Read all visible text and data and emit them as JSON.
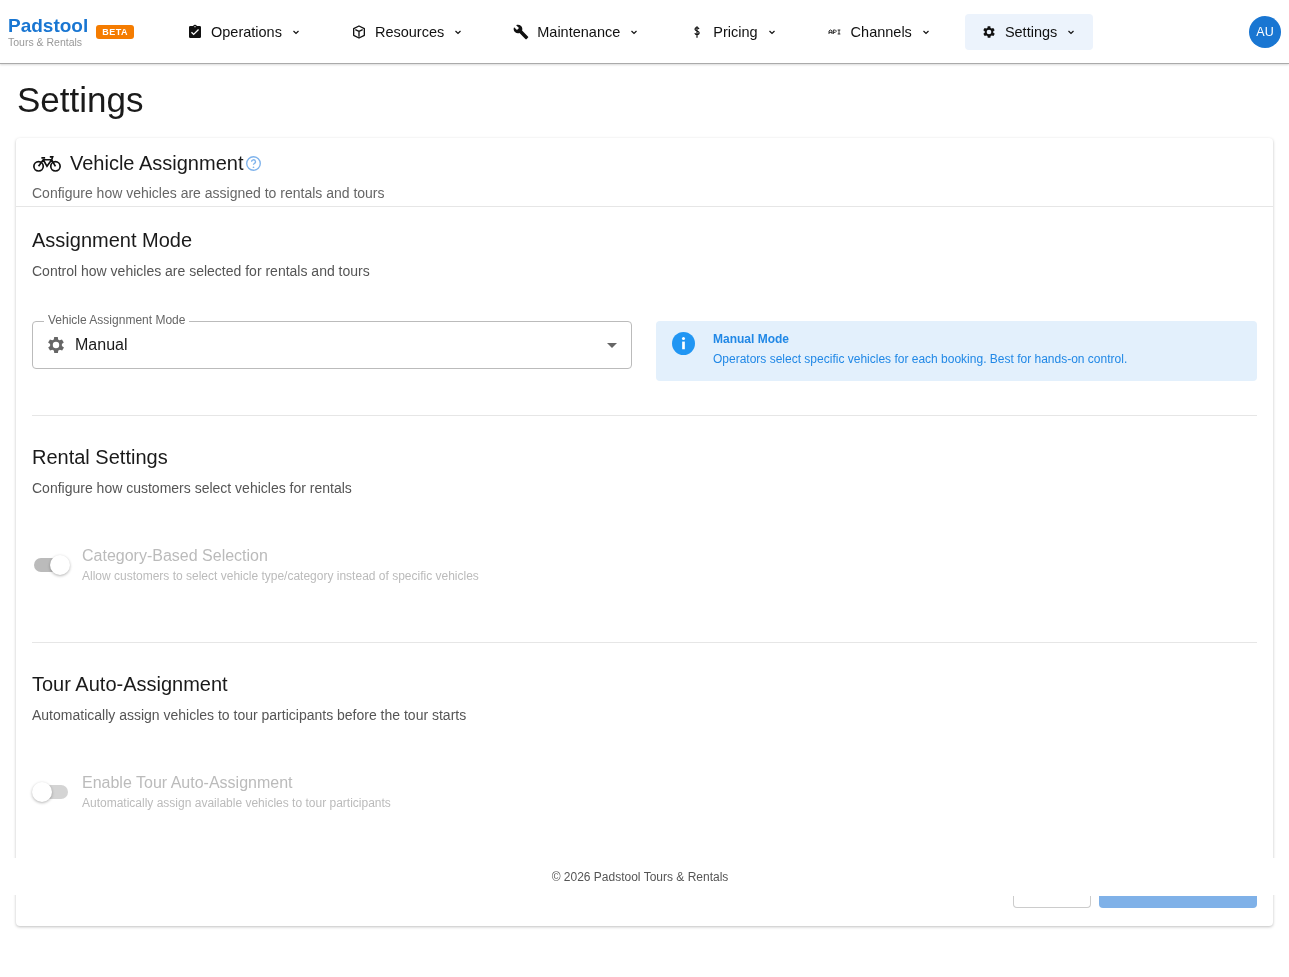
{
  "brand": {
    "name": "Padstool",
    "tagline": "Tours & Rentals",
    "badge": "BETA"
  },
  "nav": [
    {
      "label": "Operations",
      "selected": false
    },
    {
      "label": "Resources",
      "selected": false
    },
    {
      "label": "Maintenance",
      "selected": false
    },
    {
      "label": "Pricing",
      "selected": false
    },
    {
      "label": "Channels",
      "selected": false
    },
    {
      "label": "Settings",
      "selected": true
    }
  ],
  "avatar": "AU",
  "page_title": "Settings",
  "card": {
    "title": "Vehicle Assignment",
    "subtitle": "Configure how vehicles are assigned to rentals and tours"
  },
  "assignment_mode": {
    "heading": "Assignment Mode",
    "description": "Control how vehicles are selected for rentals and tours",
    "select": {
      "label": "Vehicle Assignment Mode",
      "value": "Manual"
    },
    "info": {
      "title": "Manual Mode",
      "text": "Operators select specific vehicles for each booking. Best for hands-on control."
    }
  },
  "rental_settings": {
    "heading": "Rental Settings",
    "description": "Configure how customers select vehicles for rentals",
    "toggle": {
      "label": "Category-Based Selection",
      "hint": "Allow customers to select vehicle type/category instead of specific vehicles",
      "checked": true,
      "disabled": true
    }
  },
  "tour_auto_assignment": {
    "heading": "Tour Auto-Assignment",
    "description": "Automatically assign vehicles to tour participants before the tour starts",
    "toggle": {
      "label": "Enable Tour Auto-Assignment",
      "hint": "Automatically assign available vehicles to tour participants",
      "checked": false,
      "disabled": true
    }
  },
  "actions": [
    {
      "kind": "outlined"
    },
    {
      "kind": "primary"
    }
  ],
  "footer": "© 2026 Padstool Tours & Rentals"
}
